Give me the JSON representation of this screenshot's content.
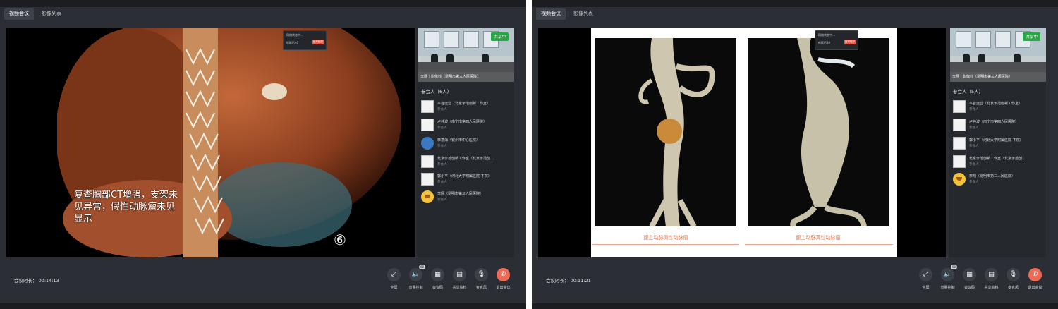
{
  "left": {
    "tabs": [
      "视频会议",
      "影像列表"
    ],
    "overlay_text": "复查胸部CT增强，支架未见异常，假性动脉瘤未见显示",
    "circled_number": "⑥",
    "popup": {
      "line1": "网络状态中…",
      "line2": "低延迟40",
      "button": "信号较好"
    },
    "camera": {
      "badge": "共享中",
      "caption": "李翔｜影像科（昆明市第三人民医院）"
    },
    "members_title": "参会人（6人）",
    "members": [
      {
        "name": "平台运营（北京示范创新工作室）",
        "role": "参会人",
        "avatar": "square"
      },
      {
        "name": "卢仲波（南宁市第四人民医院）",
        "role": "参会人",
        "avatar": "square"
      },
      {
        "name": "李意海（钦州市中心医院）",
        "role": "参会人",
        "avatar": "blue"
      },
      {
        "name": "北京示范创新工作室（北京示范创…",
        "role": "参会人",
        "avatar": "square"
      },
      {
        "name": "郭小平（河北大学附属医院-卞院）",
        "role": "参会人",
        "avatar": "square"
      },
      {
        "name": "李翔（昆明市第三人民医院）",
        "role": "参会人",
        "avatar": "emoji"
      }
    ],
    "duration_label": "会议时长：",
    "duration_value": "00:14:13"
  },
  "right": {
    "tabs": [
      "视频会议",
      "影像列表"
    ],
    "slide_captions": [
      "腹主动脉假性动脉瘤",
      "腹主动脉真性动脉瘤"
    ],
    "popup": {
      "line1": "网络状态中…",
      "line2": "低延迟40",
      "button": "信号较好"
    },
    "camera": {
      "badge": "共享中",
      "caption": "李翔｜影像科（昆明市第三人民医院）"
    },
    "members_title": "参会人（5人）",
    "members": [
      {
        "name": "平台运营（北京示范创新工作室）",
        "role": "参会人",
        "avatar": "square"
      },
      {
        "name": "卢仲波（南宁市第四人民医院）",
        "role": "参会人",
        "avatar": "square"
      },
      {
        "name": "郭小平（河北大学附属医院-卞院）",
        "role": "参会人",
        "avatar": "square"
      },
      {
        "name": "北京示范创新工作室（北京示范创…",
        "role": "参会人",
        "avatar": "square"
      },
      {
        "name": "李翔（昆明市第三人民医院）",
        "role": "参会人",
        "avatar": "emoji"
      }
    ],
    "duration_label": "会议时长：",
    "duration_value": "00:11:21"
  },
  "controls": [
    {
      "label": "全屏",
      "icon": "fullscreen-icon",
      "glyph": "⤢"
    },
    {
      "label": "音量控制",
      "icon": "volume-icon",
      "glyph": "🔈",
      "count": "68"
    },
    {
      "label": "会议码",
      "icon": "qrcode-icon",
      "glyph": "▦"
    },
    {
      "label": "共享资料",
      "icon": "document-icon",
      "glyph": "▤"
    },
    {
      "label": "麦克风",
      "icon": "microphone-icon",
      "glyph": "🎙"
    },
    {
      "label": "退出会议",
      "icon": "hangup-icon",
      "glyph": "✆"
    }
  ],
  "colors": {
    "background": "#2b2e34",
    "hangup": "#ee6a55",
    "share_badge": "#28a745",
    "caption": "#e47a52"
  }
}
